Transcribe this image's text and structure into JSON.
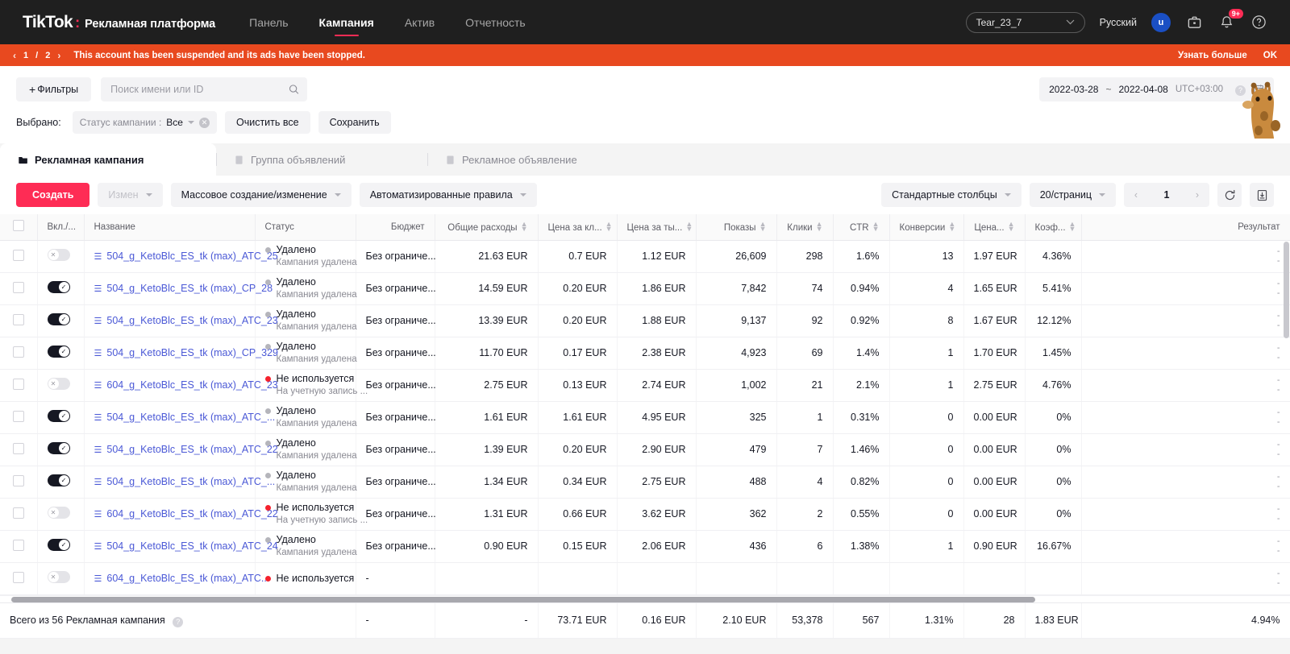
{
  "topnav": {
    "logo": "TikTok",
    "logo_colon": ":",
    "logo_sub": "Рекламная платформа",
    "links": [
      {
        "label": "Панель",
        "active": false
      },
      {
        "label": "Кампания",
        "active": true
      },
      {
        "label": "Актив",
        "active": false
      },
      {
        "label": "Отчетность",
        "active": false
      }
    ],
    "account": "Tear_23_7",
    "language": "Русский",
    "avatar_letter": "u",
    "notification_badge": "9+",
    "accent_color": "#fe2c55"
  },
  "banner": {
    "page_current": "1",
    "page_sep": "/",
    "page_total": "2",
    "prev": "‹",
    "next": "›",
    "message": "This account has been suspended and its ads have been stopped.",
    "learn_more": "Узнать больше",
    "ok": "OK",
    "color": "#e8491f"
  },
  "filterbar": {
    "filters_plus": "+",
    "filters_label": "Фильтры",
    "search_placeholder": "Поиск имени или ID",
    "search_value": "",
    "date_start": "2022-03-28",
    "date_tilde": "~",
    "date_end": "2022-04-08",
    "timezone": "UTC+03:00",
    "selected_label": "Выбрано:",
    "chip_key": "Статус кампании :",
    "chip_value": "Все",
    "clear_all": "Очистить все",
    "save": "Сохранить"
  },
  "tabs": [
    {
      "label": "Рекламная кампания",
      "active": true
    },
    {
      "label": "Группа объявлений",
      "active": false
    },
    {
      "label": "Рекламное объявление",
      "active": false
    }
  ],
  "toolbar": {
    "create": "Создать",
    "edit": "Измен",
    "bulk": "Массовое создание/изменение",
    "rules": "Автоматизированные правила",
    "columns": "Стандартные столбцы",
    "page_size": "20/страниц",
    "page_prev": "‹",
    "page_number": "1",
    "page_next": "›"
  },
  "table": {
    "columns": [
      {
        "label": "",
        "align": "c",
        "sortable": false
      },
      {
        "label": "Вкл./...",
        "align": "l",
        "sortable": false
      },
      {
        "label": "Название",
        "align": "l",
        "sortable": false
      },
      {
        "label": "Статус",
        "align": "l",
        "sortable": false
      },
      {
        "label": "Бюджет",
        "align": "r",
        "sortable": false
      },
      {
        "label": "Общие расходы",
        "align": "r",
        "sortable": true
      },
      {
        "label": "Цена за кл...",
        "align": "r",
        "sortable": true
      },
      {
        "label": "Цена за ты...",
        "align": "r",
        "sortable": true
      },
      {
        "label": "Показы",
        "align": "r",
        "sortable": true
      },
      {
        "label": "Клики",
        "align": "r",
        "sortable": true
      },
      {
        "label": "CTR",
        "align": "r",
        "sortable": true
      },
      {
        "label": "Конверсии",
        "align": "r",
        "sortable": true
      },
      {
        "label": "Цена...",
        "align": "r",
        "sortable": true
      },
      {
        "label": "Коэф...",
        "align": "r",
        "sortable": true
      },
      {
        "label": "Результат",
        "align": "r",
        "sortable": false
      }
    ],
    "rows": [
      {
        "toggle": "off",
        "name": "504_g_KetoBlc_ES_tk (max)_ATC_25",
        "status": "Удалено",
        "status_sub": "Кампания удалена",
        "status_dot": "grey",
        "budget": "Без ограниче...",
        "spend": "21.63 EUR",
        "cpc": "0.7 EUR",
        "cpm": "1.12 EUR",
        "impressions": "26,609",
        "clicks": "298",
        "ctr": "1.6%",
        "conversions": "13",
        "cost_conv": "1.97 EUR",
        "conv_rate": "4.36%",
        "result": "-"
      },
      {
        "toggle": "on",
        "name": "504_g_KetoBlc_ES_tk (max)_CP_28",
        "status": "Удалено",
        "status_sub": "Кампания удалена",
        "status_dot": "grey",
        "budget": "Без ограниче...",
        "spend": "14.59 EUR",
        "cpc": "0.20 EUR",
        "cpm": "1.86 EUR",
        "impressions": "7,842",
        "clicks": "74",
        "ctr": "0.94%",
        "conversions": "4",
        "cost_conv": "1.65 EUR",
        "conv_rate": "5.41%",
        "result": "-"
      },
      {
        "toggle": "on",
        "name": "504_g_KetoBlc_ES_tk (max)_ATC_23",
        "status": "Удалено",
        "status_sub": "Кампания удалена",
        "status_dot": "grey",
        "budget": "Без ограниче...",
        "spend": "13.39 EUR",
        "cpc": "0.20 EUR",
        "cpm": "1.88 EUR",
        "impressions": "9,137",
        "clicks": "92",
        "ctr": "0.92%",
        "conversions": "8",
        "cost_conv": "1.67 EUR",
        "conv_rate": "12.12%",
        "result": "-"
      },
      {
        "toggle": "on",
        "name": "504_g_KetoBlc_ES_tk (max)_CP_329",
        "status": "Удалено",
        "status_sub": "Кампания удалена",
        "status_dot": "grey",
        "budget": "Без ограниче...",
        "spend": "11.70 EUR",
        "cpc": "0.17 EUR",
        "cpm": "2.38 EUR",
        "impressions": "4,923",
        "clicks": "69",
        "ctr": "1.4%",
        "conversions": "1",
        "cost_conv": "1.70 EUR",
        "conv_rate": "1.45%",
        "result": "-"
      },
      {
        "toggle": "off",
        "name": "604_g_KetoBlc_ES_tk (max)_ATC_23",
        "status": "Не используется",
        "status_sub": "На учетную запись ...",
        "status_dot": "red",
        "budget": "Без ограниче...",
        "spend": "2.75 EUR",
        "cpc": "0.13 EUR",
        "cpm": "2.74 EUR",
        "impressions": "1,002",
        "clicks": "21",
        "ctr": "2.1%",
        "conversions": "1",
        "cost_conv": "2.75 EUR",
        "conv_rate": "4.76%",
        "result": "-"
      },
      {
        "toggle": "on",
        "name": "504_g_KetoBlc_ES_tk (max)_ATC_...",
        "status": "Удалено",
        "status_sub": "Кампания удалена",
        "status_dot": "grey",
        "budget": "Без ограниче...",
        "spend": "1.61 EUR",
        "cpc": "1.61 EUR",
        "cpm": "4.95 EUR",
        "impressions": "325",
        "clicks": "1",
        "ctr": "0.31%",
        "conversions": "0",
        "cost_conv": "0.00 EUR",
        "conv_rate": "0%",
        "result": "-"
      },
      {
        "toggle": "on",
        "name": "504_g_KetoBlc_ES_tk (max)_ATC_22",
        "status": "Удалено",
        "status_sub": "Кампания удалена",
        "status_dot": "grey",
        "budget": "Без ограниче...",
        "spend": "1.39 EUR",
        "cpc": "0.20 EUR",
        "cpm": "2.90 EUR",
        "impressions": "479",
        "clicks": "7",
        "ctr": "1.46%",
        "conversions": "0",
        "cost_conv": "0.00 EUR",
        "conv_rate": "0%",
        "result": "-"
      },
      {
        "toggle": "on",
        "name": "504_g_KetoBlc_ES_tk (max)_ATC_...",
        "status": "Удалено",
        "status_sub": "Кампания удалена",
        "status_dot": "grey",
        "budget": "Без ограниче...",
        "spend": "1.34 EUR",
        "cpc": "0.34 EUR",
        "cpm": "2.75 EUR",
        "impressions": "488",
        "clicks": "4",
        "ctr": "0.82%",
        "conversions": "0",
        "cost_conv": "0.00 EUR",
        "conv_rate": "0%",
        "result": "-"
      },
      {
        "toggle": "off",
        "name": "604_g_KetoBlc_ES_tk (max)_ATC_22",
        "status": "Не используется",
        "status_sub": "На учетную запись ...",
        "status_dot": "red",
        "budget": "Без ограниче...",
        "spend": "1.31 EUR",
        "cpc": "0.66 EUR",
        "cpm": "3.62 EUR",
        "impressions": "362",
        "clicks": "2",
        "ctr": "0.55%",
        "conversions": "0",
        "cost_conv": "0.00 EUR",
        "conv_rate": "0%",
        "result": "-"
      },
      {
        "toggle": "on",
        "name": "504_g_KetoBlc_ES_tk (max)_ATC_24",
        "status": "Удалено",
        "status_sub": "Кампания удалена",
        "status_dot": "grey",
        "budget": "Без ограниче...",
        "spend": "0.90 EUR",
        "cpc": "0.15 EUR",
        "cpm": "2.06 EUR",
        "impressions": "436",
        "clicks": "6",
        "ctr": "1.38%",
        "conversions": "1",
        "cost_conv": "0.90 EUR",
        "conv_rate": "16.67%",
        "result": "-"
      },
      {
        "toggle": "off",
        "name": "604_g_KetoBlc_ES_tk (max)_ATC...",
        "status": "Не используется",
        "status_sub": "",
        "status_dot": "red",
        "budget": "-",
        "spend": "",
        "cpc": "",
        "cpm": "",
        "impressions": "",
        "clicks": "",
        "ctr": "",
        "conversions": "",
        "cost_conv": "",
        "conv_rate": "",
        "result": "-"
      }
    ]
  },
  "totals": {
    "label": "Всего из 56 Рекламная кампания",
    "budget_dash1": "-",
    "budget_dash2": "-",
    "spend": "73.71 EUR",
    "cpc": "0.16 EUR",
    "cpm": "2.10 EUR",
    "impressions": "53,378",
    "clicks": "567",
    "ctr": "1.31%",
    "conversions": "28",
    "cost_conv": "1.83 EUR",
    "conv_rate": "4.94%",
    "result": "-"
  }
}
